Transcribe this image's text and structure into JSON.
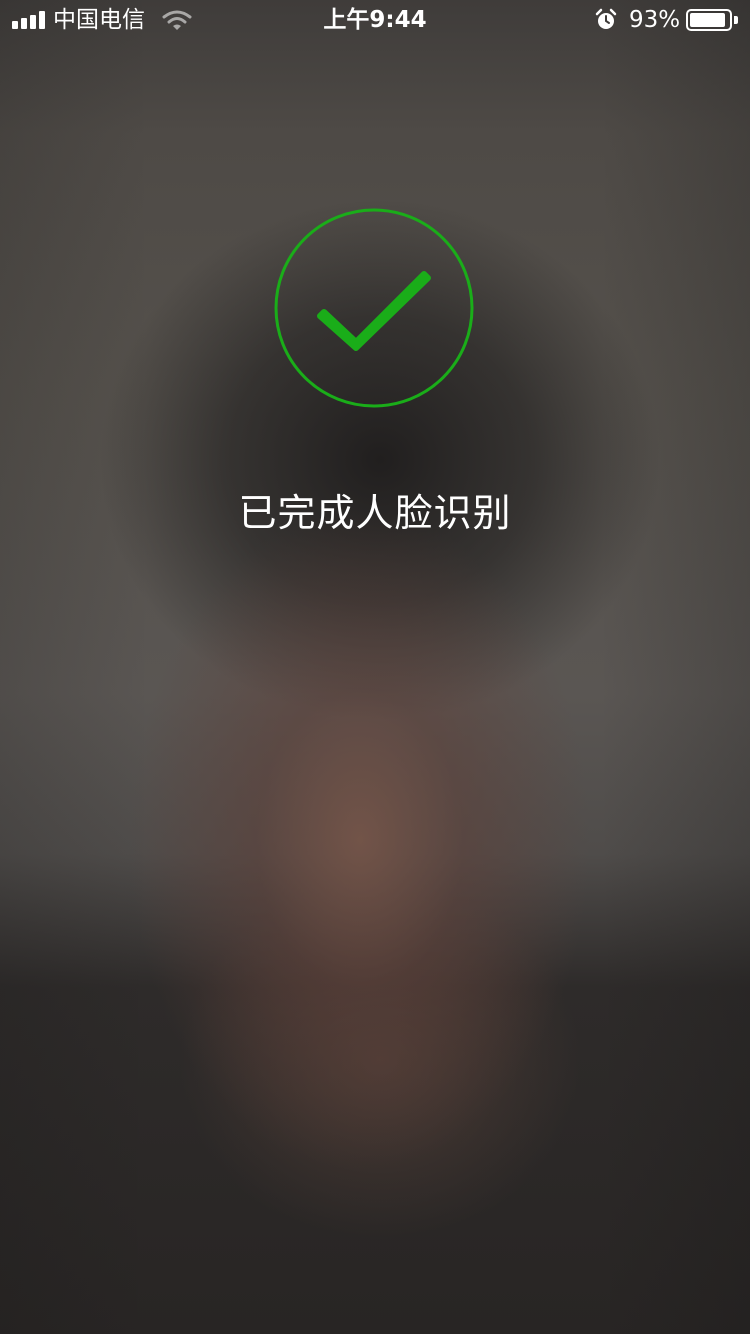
{
  "status_bar": {
    "carrier": "中国电信",
    "time": "上午9:44",
    "battery_percent": "93%",
    "battery_level": 0.93,
    "signal_bars": 4,
    "icons": [
      "signal-icon",
      "wifi-icon",
      "alarm-icon",
      "battery-icon"
    ]
  },
  "result": {
    "icon": "check-circle-icon",
    "message": "已完成人脸识别",
    "accent_color": "#1AAD19"
  }
}
